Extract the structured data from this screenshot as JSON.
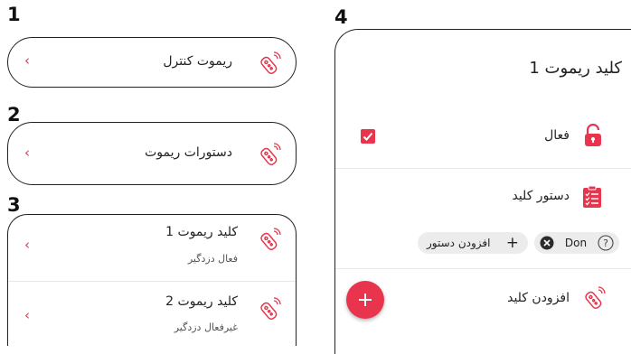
{
  "labels": {
    "n1": "1",
    "n2": "2",
    "n3": "3",
    "n4": "4"
  },
  "card1": {
    "title": "ریموت کنترل"
  },
  "card2": {
    "title": "دستورات ریموت"
  },
  "card3": {
    "items": [
      {
        "title": "کلید ریموت 1",
        "subtitle": "فعال دزدگیر"
      },
      {
        "title": "کلید ریموت 2",
        "subtitle": "غیرفعال دزدگیر"
      }
    ]
  },
  "card4": {
    "title": "کلید ریموت 1",
    "active_label": "فعال",
    "active_checked": true,
    "command_label": "دستور کلید",
    "chip_add_label": "افزودن دستور",
    "chip_command_label": "Don",
    "add_key_label": "افزودن کلید"
  },
  "colors": {
    "accent": "#e8354d",
    "chip_bg": "#ececec"
  },
  "icons": [
    "remote-icon",
    "chevron-left-icon",
    "lock-icon",
    "checklist-icon",
    "plus-icon",
    "close-circle-icon",
    "help-circle-icon",
    "checkbox-icon"
  ]
}
